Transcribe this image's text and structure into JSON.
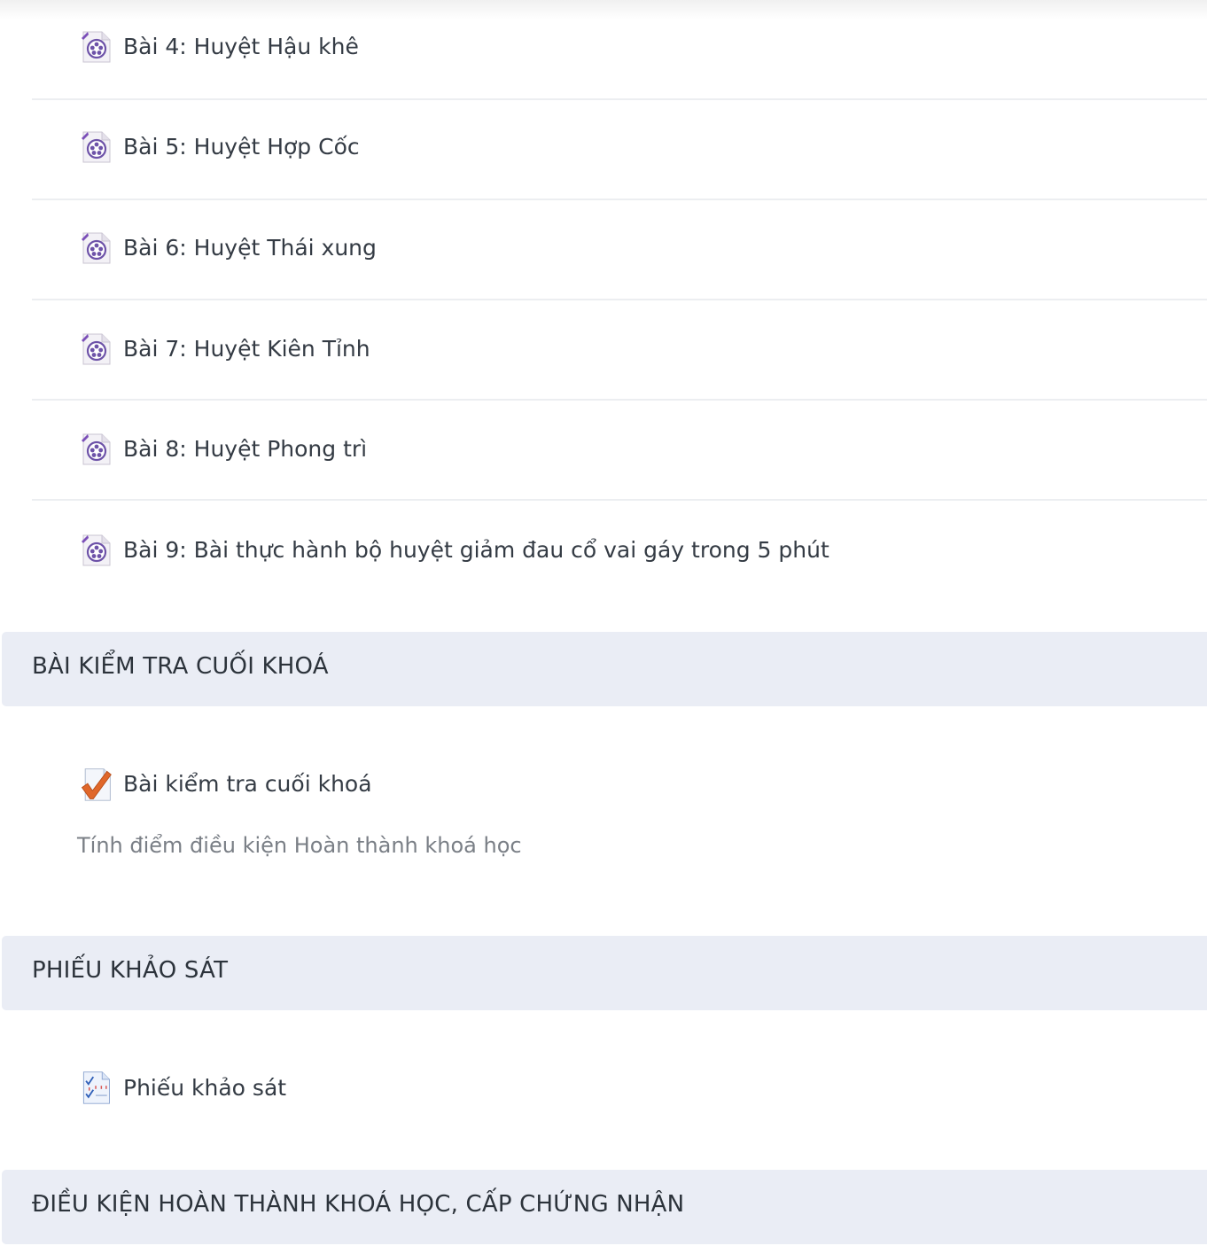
{
  "lessons": [
    {
      "label": "Bài 4: Huyệt Hậu khê",
      "icon": "video-icon"
    },
    {
      "label": "Bài 5: Huyệt Hợp Cốc",
      "icon": "video-icon"
    },
    {
      "label": "Bài 6: Huyệt Thái xung",
      "icon": "video-icon"
    },
    {
      "label": "Bài 7: Huyệt Kiên Tỉnh",
      "icon": "video-icon"
    },
    {
      "label": "Bài 8: Huyệt Phong trì",
      "icon": "video-icon"
    },
    {
      "label": "Bài 9: Bài thực hành bộ huyệt giảm đau cổ vai gáy trong 5 phút",
      "icon": "video-icon"
    }
  ],
  "sections": {
    "final_test": {
      "title": "BÀI KIỂM TRA CUỐI KHOÁ",
      "activity_label": "Bài kiểm tra cuối khoá",
      "activity_icon": "quiz-icon",
      "description": "Tính điểm điều kiện Hoàn thành khoá học"
    },
    "survey": {
      "title": "PHIẾU KHẢO SÁT",
      "activity_label": "Phiếu khảo sát",
      "activity_icon": "survey-icon"
    },
    "completion": {
      "title": "ĐIỀU KIỆN HOÀN THÀNH KHOÁ HỌC, CẤP CHỨNG NHẬN"
    }
  },
  "colors": {
    "section_bg": "#eaedf5",
    "divider": "#eceef1",
    "video_icon_accent": "#7b4fb8",
    "quiz_check": "#e0672a",
    "survey_accent": "#3b6fd1"
  }
}
